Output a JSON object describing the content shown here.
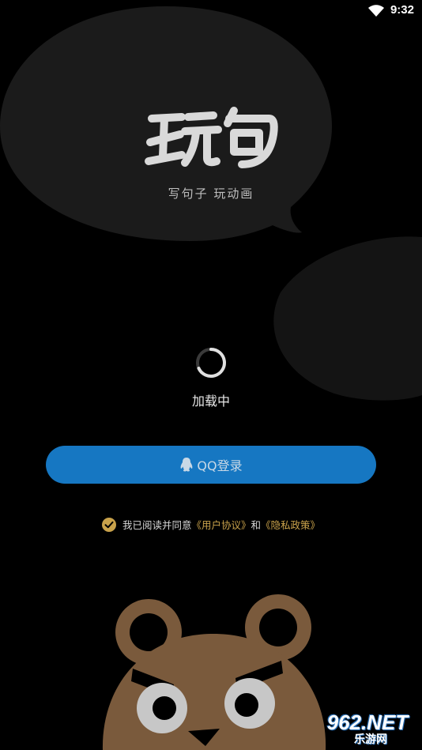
{
  "status_bar": {
    "time": "9:32"
  },
  "logo": {
    "text": "玩句"
  },
  "tagline": "写句子 玩动画",
  "loading": {
    "label": "加载中"
  },
  "login": {
    "qq_button_label": "QQ登录"
  },
  "agreement": {
    "prefix": "我已阅读并同意",
    "user_agreement": "《用户协议》",
    "conjunction": "和",
    "privacy_policy": "《隐私政策》"
  },
  "watermark": {
    "main": "962.NET",
    "sub": "乐游网"
  },
  "colors": {
    "background": "#000000",
    "bubble": "#1b1b1b",
    "qq_button": "#1677c2",
    "link": "#c9a24b",
    "bear": "#7a5a3c"
  }
}
